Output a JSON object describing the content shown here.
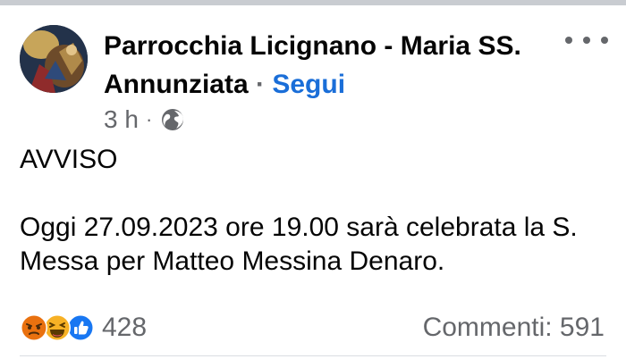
{
  "header": {
    "page_name": "Parrocchia Licignano - Maria SS. Annunziata",
    "separator": "·",
    "follow_label": "Segui"
  },
  "meta": {
    "time": "3 h",
    "separator": "·",
    "audience_icon": "globe-icon"
  },
  "post": {
    "line1": "AVVISO",
    "line2": "Oggi 27.09.2023 ore 19.00 sarà celebrata la S. Messa per Matteo Messina Denaro."
  },
  "footer": {
    "reactions": [
      "angry-icon",
      "haha-icon",
      "like-icon"
    ],
    "reaction_count": "428",
    "comments": "Commenti: 591"
  },
  "colors": {
    "follow": "#1a6ed8",
    "secondary_text": "#65676b",
    "angry": "#e9710f",
    "haha": "#f7b125",
    "like": "#1877f2"
  }
}
